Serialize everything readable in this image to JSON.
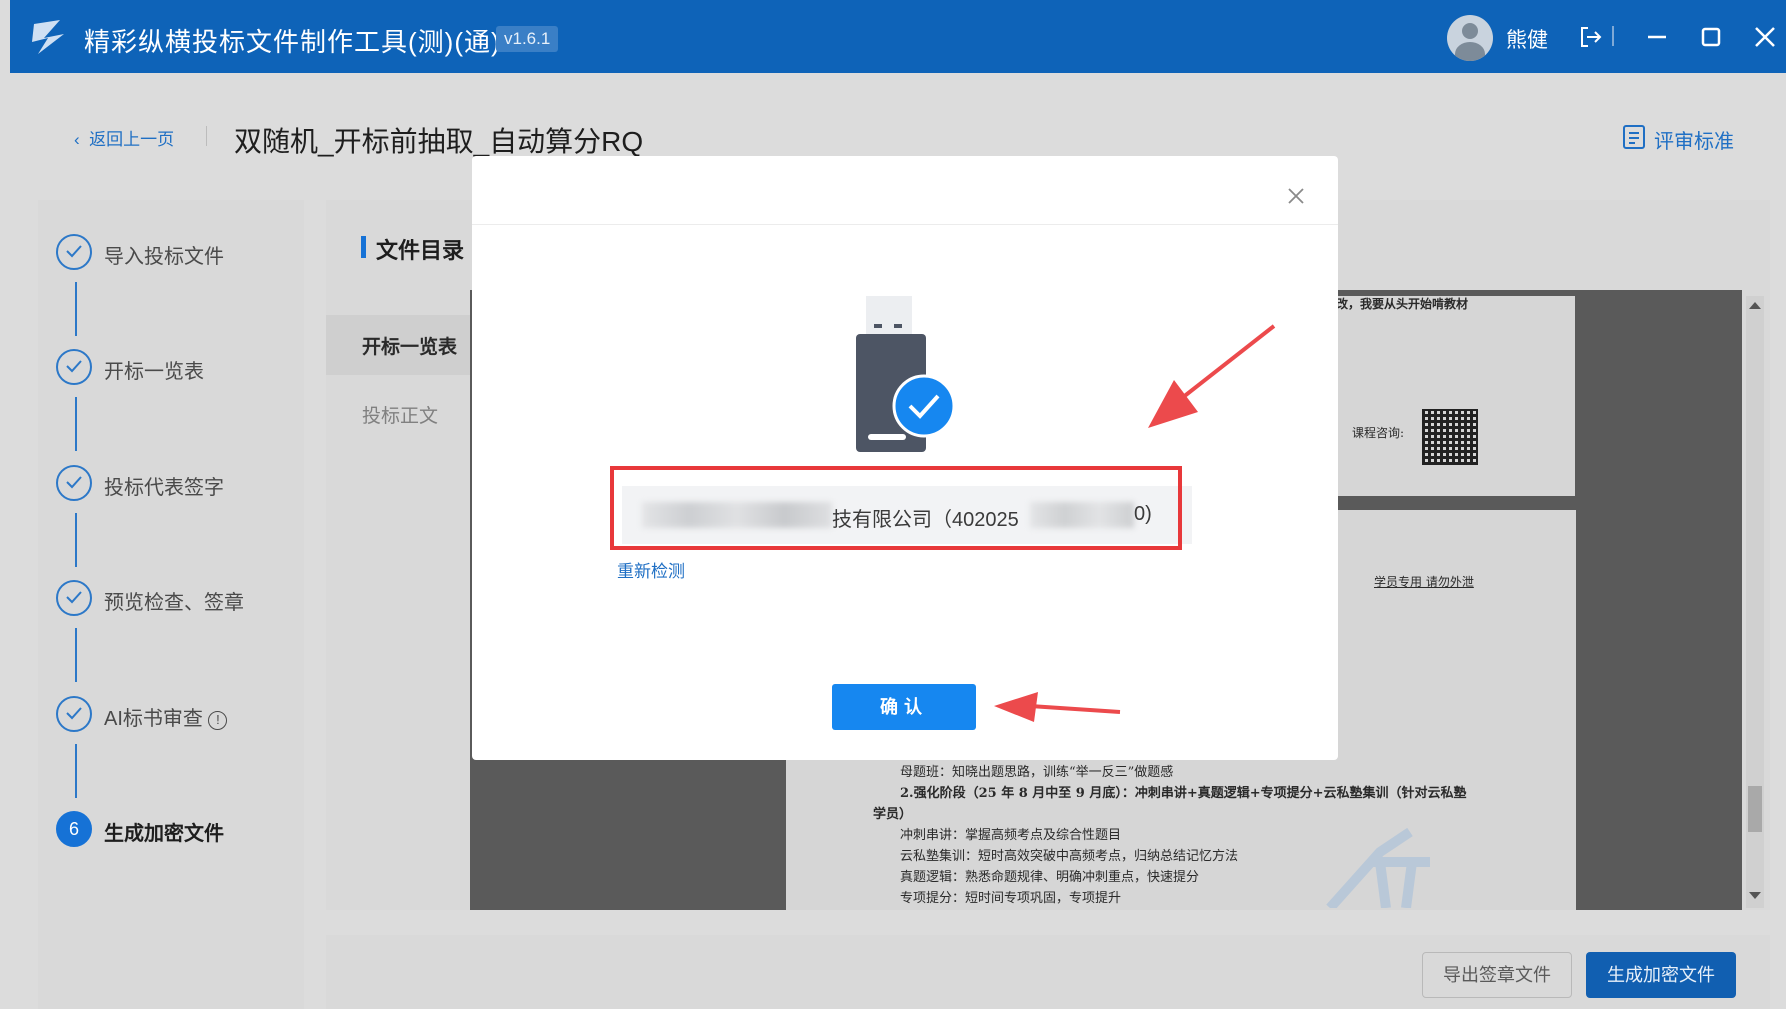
{
  "titlebar": {
    "app_title": "精彩纵横投标文件制作工具(测)(通)",
    "version": "v1.6.1",
    "username": "熊健"
  },
  "header": {
    "back_label": "返回上一页",
    "page_title": "双随机_开标前抽取_自动算分RQ",
    "criteria_label": "评审标准"
  },
  "steps": [
    {
      "label": "导入投标文件",
      "state": "done"
    },
    {
      "label": "开标一览表",
      "state": "done"
    },
    {
      "label": "投标代表签字",
      "state": "done"
    },
    {
      "label": "预览检查、签章",
      "state": "done"
    },
    {
      "label": "AI标书审查",
      "state": "done"
    },
    {
      "number": "6",
      "label": "生成加密文件",
      "state": "active"
    }
  ],
  "directory": {
    "title": "文件目录",
    "items": [
      "开标一览表",
      "投标正文"
    ]
  },
  "document": {
    "line_top": "改，我要从头开始啃教材",
    "qr_label": "课程咨询:",
    "watermark": "学员专用 请勿外泄",
    "lines": [
      "母题班：知晓出题思路，训练“举一反三”做题感",
      "2.强化阶段（25 年 8 月中至 9 月底）：冲刺串讲+真题逻辑+专项提分+云私塾集训（针对云私塾",
      "学员）",
      "冲刺串讲：掌握高频考点及综合性题目",
      "云私塾集训：短时高效突破中高频考点，归纳总结记忆方法",
      "真题逻辑：熟悉命题规律、明确冲刺重点，快速提分",
      "专项提分：短时间专项巩固，专项提升"
    ]
  },
  "footer": {
    "export_label": "导出签章文件",
    "generate_label": "生成加密文件"
  },
  "modal": {
    "device_name": "技有限公司（402025",
    "device_id_suffix": "0)",
    "redetect_label": "重新检测",
    "confirm_label": "确认"
  },
  "colors": {
    "brand_blue": "#0e63b8",
    "accent_blue": "#1687f0",
    "highlight_red": "#e8383a"
  }
}
